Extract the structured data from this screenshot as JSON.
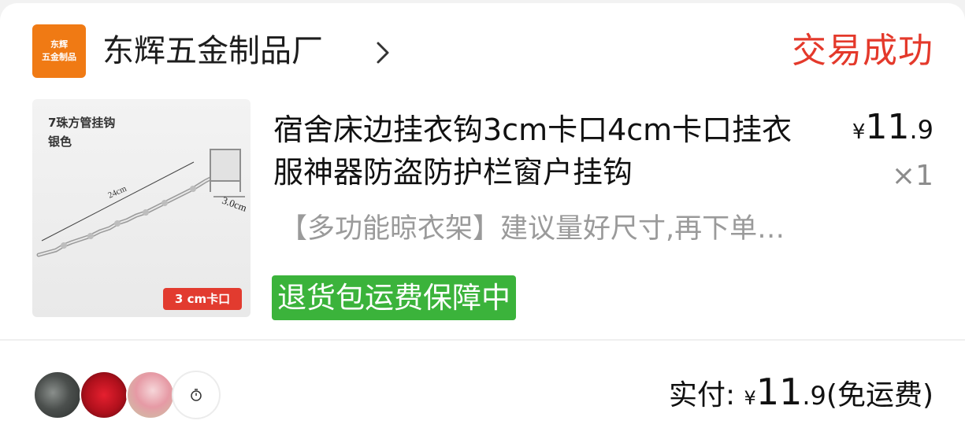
{
  "order": {
    "shop": {
      "logo_line1": "东辉",
      "logo_line2": "五金制品",
      "name": "东辉五金制品厂"
    },
    "status": "交易成功",
    "product": {
      "image_title": "7珠方管挂钩",
      "image_subtitle": "银色",
      "image_dim1": "24cm",
      "image_dim2": "3.0cm",
      "image_tag": "3 cm卡口",
      "title": "宿舍床边挂衣钩3cm卡口4cm卡口挂衣服神器防盗防护栏窗户挂钩",
      "description": "【多功能晾衣架】建议量好尺寸,再下单购买",
      "badge": "退货包运费保障中",
      "price_currency": "¥",
      "price_int": "11",
      "price_dec": ".9",
      "quantity": "×1"
    },
    "payment": {
      "label": "实付: ",
      "currency": "¥",
      "amount_int": "11",
      "amount_dec": ".9",
      "shipping": "(免运费)"
    }
  },
  "colors": {
    "status": "#e4392b",
    "badge": "#3bb33b",
    "logo": "#f07a14",
    "image_tag": "#e23b2f"
  }
}
